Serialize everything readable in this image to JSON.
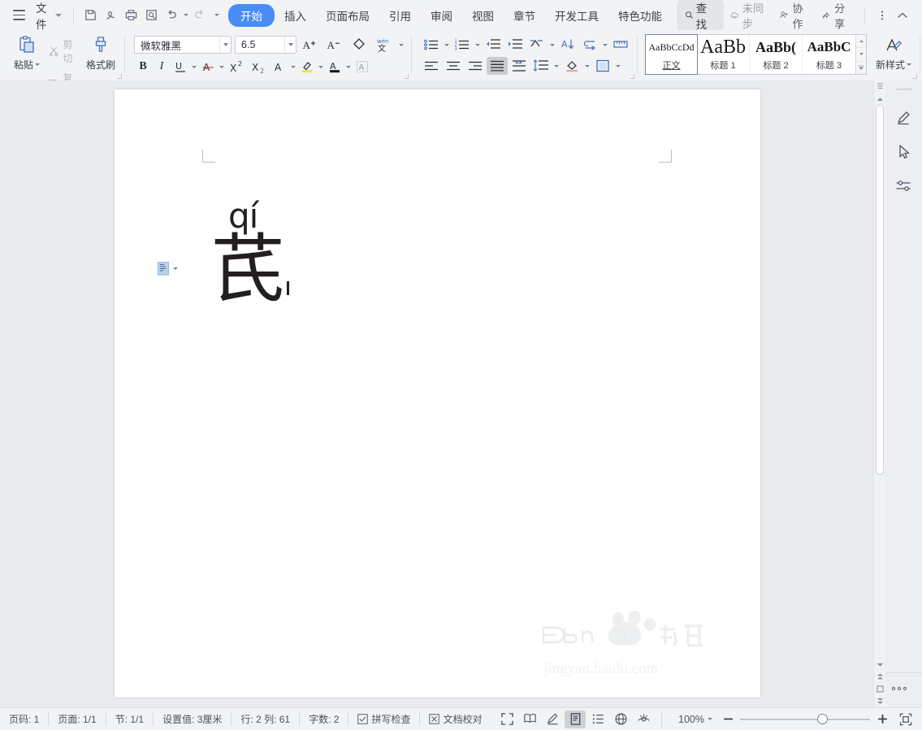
{
  "menubar": {
    "file_label": "文件",
    "quick_icons": [
      "save-icon",
      "save-as-icon",
      "print-icon",
      "print-preview-icon",
      "undo-icon",
      "redo-icon",
      "customize-icon"
    ],
    "tabs": [
      {
        "label": "开始",
        "active": true
      },
      {
        "label": "插入",
        "active": false
      },
      {
        "label": "页面布局",
        "active": false
      },
      {
        "label": "引用",
        "active": false
      },
      {
        "label": "审阅",
        "active": false
      },
      {
        "label": "视图",
        "active": false
      },
      {
        "label": "章节",
        "active": false
      },
      {
        "label": "开发工具",
        "active": false
      },
      {
        "label": "特色功能",
        "active": false
      }
    ],
    "find_label": "查找",
    "sync_label": "未同步",
    "collab_label": "协作",
    "share_label": "分享"
  },
  "ribbon": {
    "clipboard": {
      "paste_label": "粘贴",
      "cut_label": "剪切",
      "copy_label": "复制",
      "format_painter_label": "格式刷"
    },
    "font": {
      "family": "微软雅黑",
      "size": "6.5",
      "bold_label": "B",
      "italic_label": "I",
      "underline_label": "U",
      "strikethrough_label": "A",
      "superscript_label": "X²",
      "subscript_label": "X₂",
      "char_border_label": "A",
      "grow_font_label": "A+",
      "shrink_font_label": "A−",
      "clear_format_label": "clear-format-icon",
      "pinyin_guide_label": "wén",
      "highlight_label": "highlight-icon",
      "font_color_label": "font-color-icon",
      "char_shading_label": "char-shading-icon"
    },
    "paragraph": {
      "bullets": "bullet-list-icon",
      "numbering": "numbered-list-icon",
      "decrease_indent": "decrease-indent-icon",
      "increase_indent": "increase-indent-icon",
      "multilevel": "multilevel-list-icon",
      "sort": "sort-icon",
      "show_marks": "show-paragraph-marks-icon",
      "ruler": "ruler-icon",
      "align_left": "align-left-icon",
      "align_center": "align-center-icon",
      "align_right": "align-right-icon",
      "align_justify": "align-justify-icon",
      "distribute": "distribute-icon",
      "line_spacing": "line-spacing-icon",
      "shading": "shading-icon",
      "borders": "borders-icon",
      "active_align": "align-justify-icon"
    },
    "styles": {
      "items": [
        {
          "preview": "AaBbCcDd",
          "name": "正文",
          "selected": true
        },
        {
          "preview": "AaBb",
          "name": "标题 1",
          "selected": false
        },
        {
          "preview": "AaBb(",
          "name": "标题 2",
          "selected": false
        },
        {
          "preview": "AaBbC",
          "name": "标题 3",
          "selected": false
        }
      ],
      "new_style_label": "新样式",
      "text_tool_label": "文字"
    }
  },
  "document": {
    "pinyin": "qí",
    "character": "芪",
    "smart_tag": "paste-options-icon",
    "watermark_main": "Baidu 经验",
    "watermark_url": "jingyan.baidu.com"
  },
  "statusbar": {
    "left_items": [
      {
        "label": "页码: 1",
        "icon": null
      },
      {
        "label": "页面: 1/1",
        "icon": null
      },
      {
        "label": "节: 1/1",
        "icon": null
      },
      {
        "label": "设置值: 3厘米",
        "icon": null
      },
      {
        "label": "行: 2    列: 61",
        "icon": null
      },
      {
        "label": "字数: 2",
        "icon": null
      },
      {
        "label": "拼写检查",
        "icon": "check-box-icon"
      },
      {
        "label": "文档校对",
        "icon": "x-box-icon"
      }
    ],
    "view_buttons": [
      {
        "name": "fullscreen-icon",
        "active": false
      },
      {
        "name": "reading-layout-icon",
        "active": false
      },
      {
        "name": "writing-layout-icon",
        "active": false
      },
      {
        "name": "print-layout-icon",
        "active": true
      },
      {
        "name": "outline-view-icon",
        "active": false
      },
      {
        "name": "web-layout-icon",
        "active": false
      },
      {
        "name": "eye-protection-icon",
        "active": false
      }
    ],
    "zoom": "100%",
    "zoom_minus": "−",
    "zoom_plus": "+",
    "fit_page": "fit-page-icon"
  },
  "rail": {
    "icons": [
      "pen-tool-icon",
      "select-cursor-icon",
      "settings-sliders-icon"
    ],
    "more_label": "more-options-icon"
  }
}
